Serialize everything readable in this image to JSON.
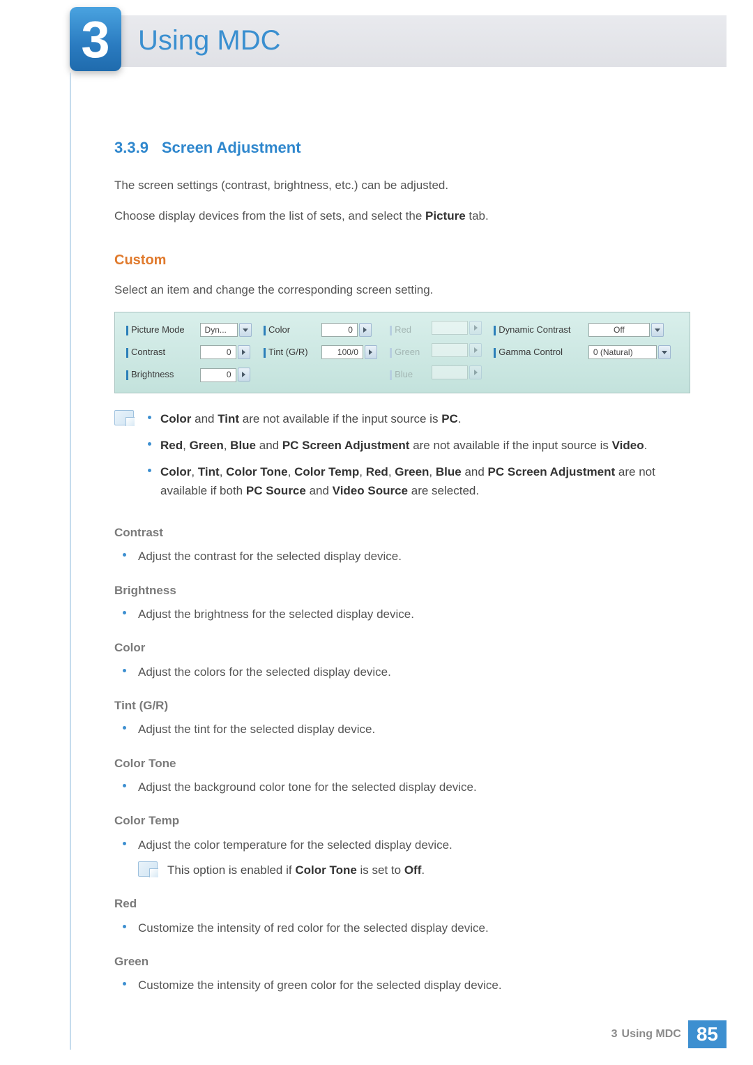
{
  "header": {
    "chapter_number": "3",
    "chapter_title": "Using MDC"
  },
  "section": {
    "number": "3.3.9",
    "title": "Screen Adjustment"
  },
  "intro": {
    "p1": "The screen settings (contrast, brightness, etc.) can be adjusted.",
    "p2_a": "Choose display devices from the list of sets, and select the ",
    "p2_bold": "Picture",
    "p2_b": " tab."
  },
  "custom": {
    "heading": "Custom",
    "p": "Select an item and change the corresponding screen setting."
  },
  "panel": {
    "picture_mode": {
      "label": "Picture Mode",
      "value": "Dyn..."
    },
    "contrast": {
      "label": "Contrast",
      "value": "0"
    },
    "brightness": {
      "label": "Brightness",
      "value": "0"
    },
    "color": {
      "label": "Color",
      "value": "0"
    },
    "tint": {
      "label": "Tint (G/R)",
      "value": "100/0"
    },
    "red": {
      "label": "Red"
    },
    "green": {
      "label": "Green"
    },
    "blue": {
      "label": "Blue"
    },
    "dyn_contrast": {
      "label": "Dynamic Contrast",
      "value": "Off"
    },
    "gamma": {
      "label": "Gamma Control",
      "value": "0 (Natural)"
    }
  },
  "notes": {
    "n1": {
      "b1": "Color",
      "t1": " and ",
      "b2": "Tint",
      "t2": " are not available if the input source is ",
      "b3": "PC",
      "t3": "."
    },
    "n2": {
      "b1": "Red",
      "t1": ", ",
      "b2": "Green",
      "t2": ", ",
      "b3": "Blue",
      "t3": " and ",
      "b4": "PC Screen Adjustment",
      "t4": " are not available if the input source is ",
      "b5": "Video",
      "t5": "."
    },
    "n3": {
      "b1": "Color",
      "t1": ", ",
      "b2": "Tint",
      "t2": ", ",
      "b3": "Color Tone",
      "t3": ", ",
      "b4": "Color Temp",
      "t4": ", ",
      "b5": "Red",
      "t5": ", ",
      "b6": "Green",
      "t6": ", ",
      "b7": "Blue",
      "t7": " and ",
      "b8": "PC Screen Adjustment",
      "t8": " are not available if both ",
      "b9": "PC Source",
      "t9": " and ",
      "b10": "Video Source",
      "t10": " are selected."
    }
  },
  "defs": {
    "contrast": {
      "h": "Contrast",
      "p": "Adjust the contrast for the selected display device."
    },
    "brightness": {
      "h": "Brightness",
      "p": "Adjust the brightness for the selected display device."
    },
    "color": {
      "h": "Color",
      "p": "Adjust the colors for the selected display device."
    },
    "tint": {
      "h": "Tint (G/R)",
      "p": "Adjust the tint for the selected display device."
    },
    "colortone": {
      "h": "Color Tone",
      "p": "Adjust the background color tone for the selected display device."
    },
    "colortemp": {
      "h": "Color Temp",
      "p": "Adjust the color temperature for the selected display device.",
      "note_a": "This option is enabled if ",
      "note_b1": "Color Tone",
      "note_b": " is set to ",
      "note_b2": "Off",
      "note_c": "."
    },
    "red": {
      "h": "Red",
      "p": "Customize the intensity of red color for the selected display device."
    },
    "green": {
      "h": "Green",
      "p": "Customize the intensity of green color for the selected display device."
    }
  },
  "footer": {
    "chapnum": "3",
    "label": "Using MDC",
    "page": "85"
  }
}
